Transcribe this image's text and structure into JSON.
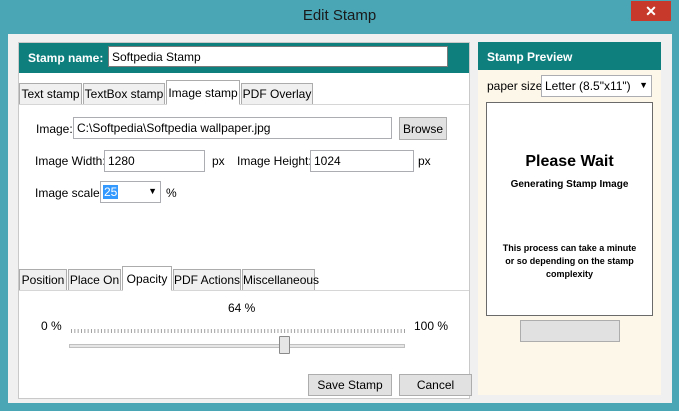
{
  "window": {
    "title": "Edit Stamp",
    "close_glyph": "✕"
  },
  "stamp_name": {
    "label": "Stamp name:",
    "value": "Softpedia Stamp"
  },
  "stamp_tabs": [
    "Text stamp",
    "TextBox stamp",
    "Image stamp",
    "PDF Overlay"
  ],
  "active_stamp_tab": "Image stamp",
  "image": {
    "label": "Image:",
    "path": "C:\\Softpedia\\Softpedia wallpaper.jpg",
    "browse_label": "Browse",
    "width_label": "Image Width:",
    "width_value": "1280",
    "width_unit": "px",
    "height_label": "Image Height:",
    "height_value": "1024",
    "height_unit": "px",
    "scale_label": "Image scale:",
    "scale_value": "25",
    "scale_unit": "%"
  },
  "option_tabs": [
    "Position",
    "Place On",
    "Opacity",
    "PDF Actions",
    "Miscellaneous"
  ],
  "active_option_tab": "Opacity",
  "opacity": {
    "value_text": "64 %",
    "min_label": "0 %",
    "max_label": "100 %",
    "value": 64
  },
  "actions": {
    "save_label": "Save Stamp",
    "cancel_label": "Cancel"
  },
  "preview": {
    "header": "Stamp Preview",
    "paper_size_label": "paper size:",
    "paper_size_value": "Letter (8.5\"x11\")",
    "heading": "Please Wait",
    "subheading": "Generating Stamp Image",
    "note": "This process can take a minute or so depending on the stamp complexity"
  },
  "colors": {
    "titlebar": "#4aa5b5",
    "accent": "#0f7f7e",
    "close": "#c7392b"
  }
}
